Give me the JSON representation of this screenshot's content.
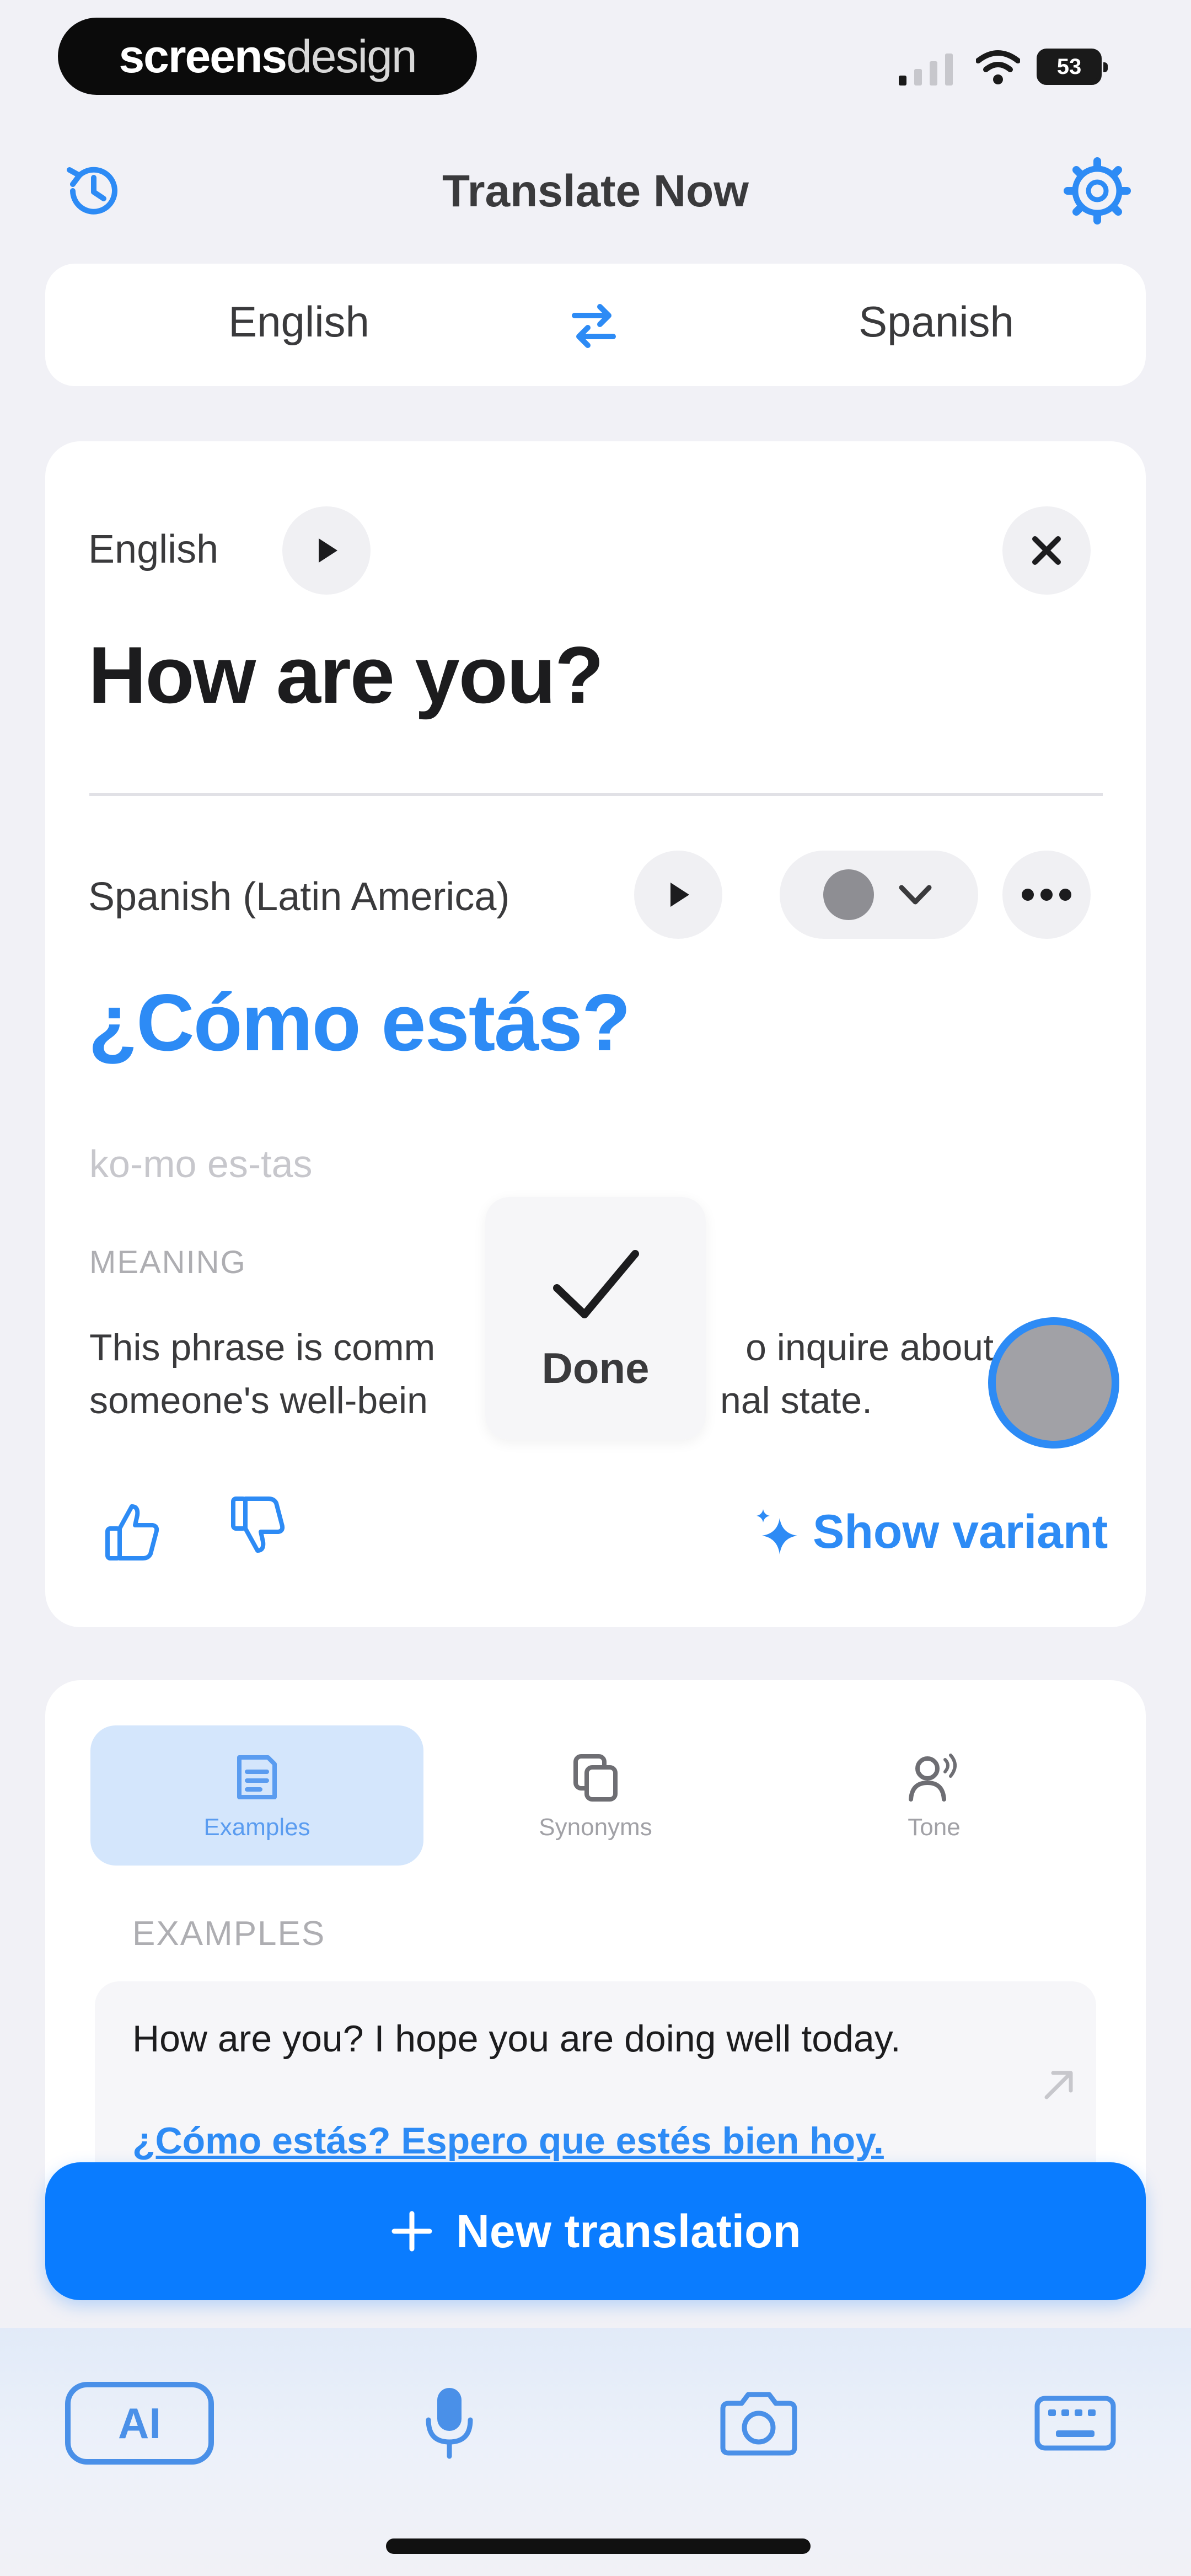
{
  "watermark": {
    "bold": "screens",
    "light": "design"
  },
  "status_bar": {
    "battery": "53"
  },
  "header": {
    "title": "Translate Now",
    "left_icon": "history-icon",
    "right_icon": "gear-icon"
  },
  "language_bar": {
    "source": "English",
    "target": "Spanish",
    "swap_icon": "swap-arrows-icon"
  },
  "source": {
    "language": "English",
    "text": "How are you?"
  },
  "target": {
    "language": "Spanish (Latin America)",
    "text": "¿Cómo estás?",
    "pronunciation": "ko-mo es-tas",
    "meaning_heading": "MEANING",
    "meaning_visible_left_line1": "This phrase is comm",
    "meaning_visible_right_line1": "o inquire about",
    "meaning_visible_left_line2": "someone's well-bein",
    "meaning_visible_right_line2": "nal state.",
    "show_variant": "Show variant"
  },
  "hud": {
    "label": "Done"
  },
  "tabs": [
    {
      "label": "Examples",
      "active": true
    },
    {
      "label": "Synonyms",
      "active": false
    },
    {
      "label": "Tone",
      "active": false
    }
  ],
  "examples": {
    "heading": "EXAMPLES",
    "items": [
      {
        "en": "How are you? I hope you are doing well today.",
        "es": "¿Cómo estás? Espero que estés bien hoy."
      }
    ]
  },
  "cta": {
    "label": "New translation"
  },
  "bottom_bar": {
    "ai_label": "AI"
  },
  "colors": {
    "accent": "#0a7cff",
    "link": "#2d8bf5",
    "background": "#f1f1f6"
  }
}
